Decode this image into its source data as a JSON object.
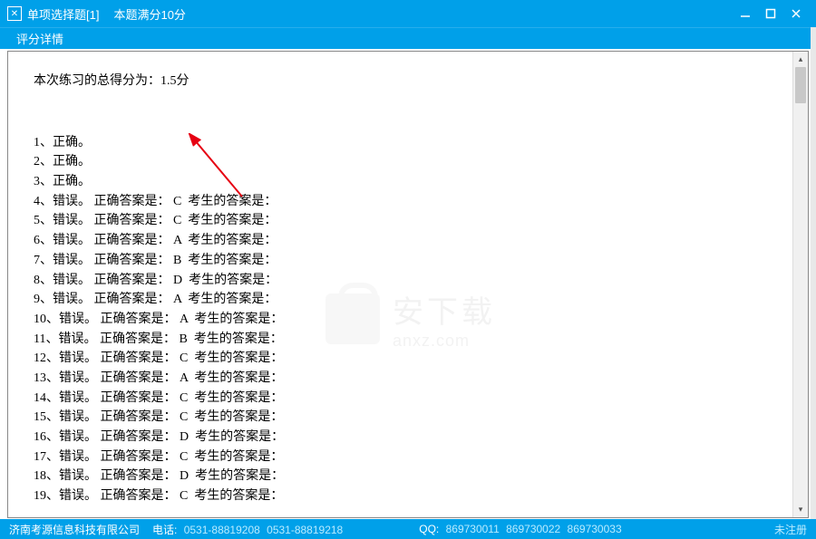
{
  "titlebar": {
    "icon_glyph": "✕",
    "title": "单项选择题[1]",
    "subtitle": "本题满分10分"
  },
  "subheader": {
    "label": "评分详情"
  },
  "score": {
    "text": "本次练习的总得分为：1.5分"
  },
  "results": [
    {
      "idx": "1、",
      "status": "正确。",
      "correct": "",
      "student": ""
    },
    {
      "idx": "2、",
      "status": "正确。",
      "correct": "",
      "student": ""
    },
    {
      "idx": "3、",
      "status": "正确。",
      "correct": "",
      "student": ""
    },
    {
      "idx": "4、",
      "status": "错误。",
      "correct": "正确答案是： C",
      "student": "考生的答案是："
    },
    {
      "idx": "5、",
      "status": "错误。",
      "correct": "正确答案是： C",
      "student": "考生的答案是："
    },
    {
      "idx": "6、",
      "status": "错误。",
      "correct": "正确答案是： A",
      "student": "考生的答案是："
    },
    {
      "idx": "7、",
      "status": "错误。",
      "correct": "正确答案是： B",
      "student": "考生的答案是："
    },
    {
      "idx": "8、",
      "status": "错误。",
      "correct": "正确答案是： D",
      "student": "考生的答案是："
    },
    {
      "idx": "9、",
      "status": "错误。",
      "correct": "正确答案是： A",
      "student": "考生的答案是："
    },
    {
      "idx": "10、",
      "status": "错误。",
      "correct": "正确答案是： A",
      "student": "考生的答案是："
    },
    {
      "idx": "11、",
      "status": "错误。",
      "correct": "正确答案是： B",
      "student": "考生的答案是："
    },
    {
      "idx": "12、",
      "status": "错误。",
      "correct": "正确答案是： C",
      "student": "考生的答案是："
    },
    {
      "idx": "13、",
      "status": "错误。",
      "correct": "正确答案是： A",
      "student": "考生的答案是："
    },
    {
      "idx": "14、",
      "status": "错误。",
      "correct": "正确答案是： C",
      "student": "考生的答案是："
    },
    {
      "idx": "15、",
      "status": "错误。",
      "correct": "正确答案是： C",
      "student": "考生的答案是："
    },
    {
      "idx": "16、",
      "status": "错误。",
      "correct": "正确答案是： D",
      "student": "考生的答案是："
    },
    {
      "idx": "17、",
      "status": "错误。",
      "correct": "正确答案是： C",
      "student": "考生的答案是："
    },
    {
      "idx": "18、",
      "status": "错误。",
      "correct": "正确答案是： D",
      "student": "考生的答案是："
    },
    {
      "idx": "19、",
      "status": "错误。",
      "correct": "正确答案是： C",
      "student": "考生的答案是："
    }
  ],
  "footer": {
    "company": "济南考源信息科技有限公司",
    "phone_label": "电话:",
    "phone1": "0531-88819208",
    "phone2": "0531-88819218",
    "qq_label": "QQ:",
    "qq1": "869730011",
    "qq2": "869730022",
    "qq3": "869730033",
    "status": "未注册"
  },
  "watermark": {
    "cn": "安下载",
    "url": "anxz.com"
  }
}
